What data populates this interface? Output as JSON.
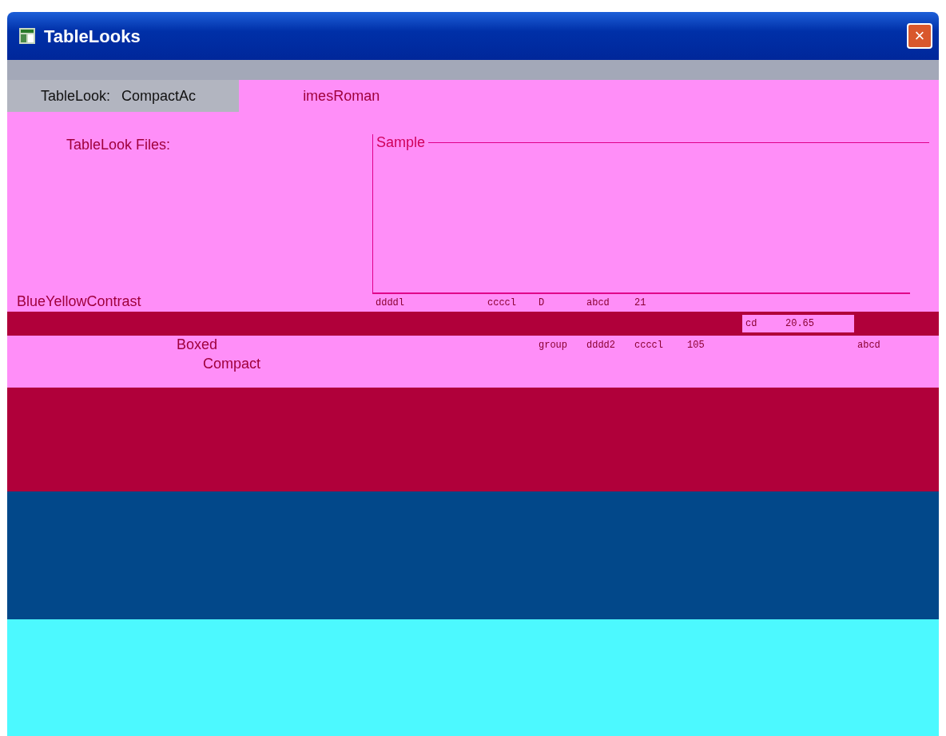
{
  "window": {
    "title": "TableLooks",
    "close": "×"
  },
  "tablelook": {
    "label": "TableLook:",
    "value": "CompactAc",
    "font": "imesRoman"
  },
  "files": {
    "label": "TableLook Files:",
    "items": [
      "BlueYellowContrast",
      "Boxed",
      "Compact"
    ]
  },
  "sample": {
    "title": "Sample",
    "rows": [
      [
        "ddddl",
        "ccccl",
        "D",
        "abcd",
        "21"
      ],
      [
        "",
        "",
        "",
        "",
        "",
        "",
        "cd",
        "20.65"
      ],
      [
        "",
        "",
        "group",
        "dddd2",
        "ccccl",
        "105",
        "",
        "",
        "abcd"
      ]
    ]
  }
}
